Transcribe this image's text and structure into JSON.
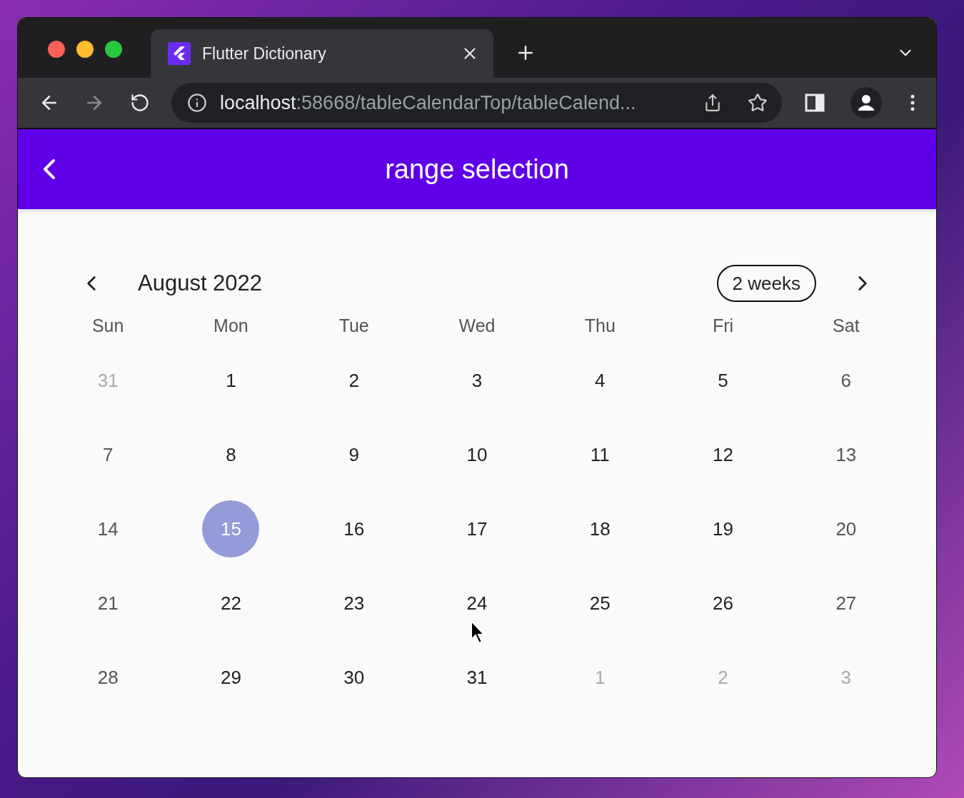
{
  "browser": {
    "tab": {
      "title": "Flutter Dictionary",
      "selected": true
    },
    "url": {
      "host": "localhost",
      "rest": ":58668/tableCalendarTop/tableCalend..."
    }
  },
  "app_bar": {
    "title": "range selection"
  },
  "calendar": {
    "month": "August 2022",
    "format_button": "2 weeks",
    "weekdays": [
      "Sun",
      "Mon",
      "Tue",
      "Wed",
      "Thu",
      "Fri",
      "Sat"
    ],
    "weeks": [
      [
        {
          "text": "31",
          "kind": "outside",
          "selected": false
        },
        {
          "text": "1",
          "kind": "weekday",
          "selected": false
        },
        {
          "text": "2",
          "kind": "weekday",
          "selected": false
        },
        {
          "text": "3",
          "kind": "weekday",
          "selected": false
        },
        {
          "text": "4",
          "kind": "weekday",
          "selected": false
        },
        {
          "text": "5",
          "kind": "weekday",
          "selected": false
        },
        {
          "text": "6",
          "kind": "weekend",
          "selected": false
        }
      ],
      [
        {
          "text": "7",
          "kind": "weekend",
          "selected": false
        },
        {
          "text": "8",
          "kind": "weekday",
          "selected": false
        },
        {
          "text": "9",
          "kind": "weekday",
          "selected": false
        },
        {
          "text": "10",
          "kind": "weekday",
          "selected": false
        },
        {
          "text": "11",
          "kind": "weekday",
          "selected": false
        },
        {
          "text": "12",
          "kind": "weekday",
          "selected": false
        },
        {
          "text": "13",
          "kind": "weekend",
          "selected": false
        }
      ],
      [
        {
          "text": "14",
          "kind": "weekend",
          "selected": false
        },
        {
          "text": "15",
          "kind": "weekday",
          "selected": true
        },
        {
          "text": "16",
          "kind": "weekday",
          "selected": false
        },
        {
          "text": "17",
          "kind": "weekday",
          "selected": false
        },
        {
          "text": "18",
          "kind": "weekday",
          "selected": false
        },
        {
          "text": "19",
          "kind": "weekday",
          "selected": false
        },
        {
          "text": "20",
          "kind": "weekend",
          "selected": false
        }
      ],
      [
        {
          "text": "21",
          "kind": "weekend",
          "selected": false
        },
        {
          "text": "22",
          "kind": "weekday",
          "selected": false
        },
        {
          "text": "23",
          "kind": "weekday",
          "selected": false
        },
        {
          "text": "24",
          "kind": "weekday",
          "selected": false
        },
        {
          "text": "25",
          "kind": "weekday",
          "selected": false
        },
        {
          "text": "26",
          "kind": "weekday",
          "selected": false
        },
        {
          "text": "27",
          "kind": "weekend",
          "selected": false
        }
      ],
      [
        {
          "text": "28",
          "kind": "weekend",
          "selected": false
        },
        {
          "text": "29",
          "kind": "weekday",
          "selected": false
        },
        {
          "text": "30",
          "kind": "weekday",
          "selected": false
        },
        {
          "text": "31",
          "kind": "weekday",
          "selected": false
        },
        {
          "text": "1",
          "kind": "outside",
          "selected": false
        },
        {
          "text": "2",
          "kind": "outside",
          "selected": false
        },
        {
          "text": "3",
          "kind": "outside",
          "selected": false
        }
      ]
    ]
  }
}
